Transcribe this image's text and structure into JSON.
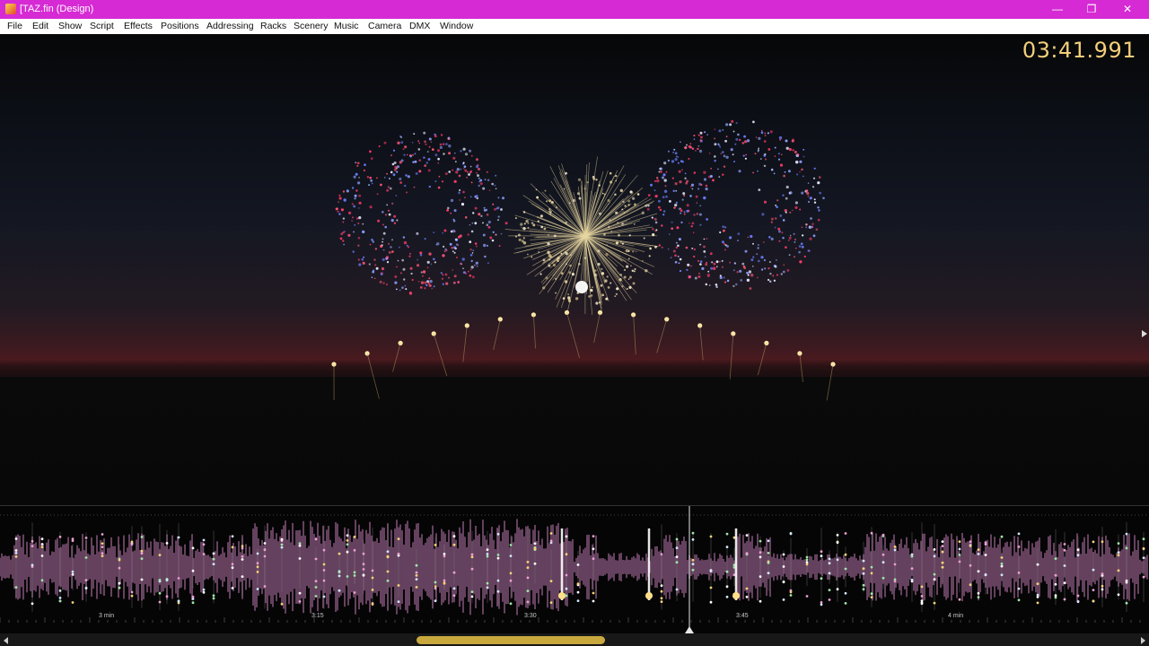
{
  "window": {
    "title": "[TAZ.fin (Design)",
    "controls": {
      "minimize": "—",
      "restore": "❐",
      "close": "✕"
    }
  },
  "menu": [
    "File",
    "Edit",
    "Show",
    "Script",
    "Effects",
    "Positions",
    "Addressing",
    "Racks",
    "Scenery",
    "Music",
    "Camera",
    "DMX",
    "Window"
  ],
  "viewport": {
    "timecode": "03:41.991",
    "accent_color": "#f2cf7a"
  },
  "timeline": {
    "tick_labels": [
      "3 min",
      "3:15",
      "3:30",
      "3:45",
      "4 min"
    ],
    "playhead_time": "03:41.991",
    "waveform_color": "#a56a9a"
  },
  "colors": {
    "titlebar": "#d62ad4",
    "scroll_thumb": "#c9a93e"
  },
  "icons": {
    "app": "app-icon",
    "minimize": "minimize-icon",
    "restore": "restore-icon",
    "close": "close-icon"
  }
}
